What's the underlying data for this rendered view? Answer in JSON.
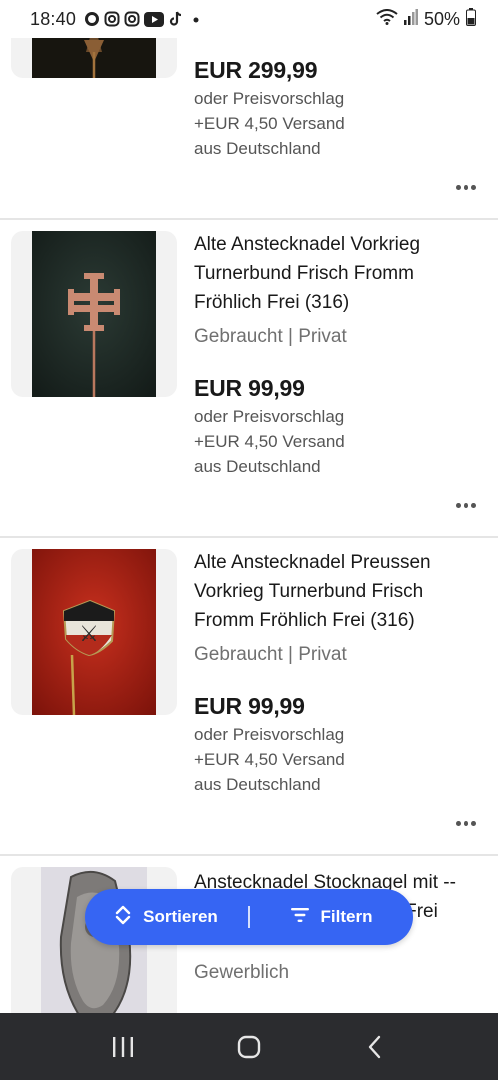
{
  "status_bar": {
    "time": "18:40",
    "battery": "50%",
    "notification_icons": [
      "chat-bubble-icon",
      "instagram-icon",
      "instagram-icon",
      "youtube-icon",
      "tiktok-icon",
      "dot-icon"
    ],
    "right_icons": [
      "wifi-icon",
      "signal-icon",
      "battery-icon"
    ]
  },
  "listings": [
    {
      "title": "",
      "condition": "",
      "price": "EUR 299,99",
      "offer": "oder Preisvorschlag",
      "shipping": "+EUR 4,50 Versand",
      "origin": "aus Deutschland"
    },
    {
      "title": "Alte Anstecknadel Vorkrieg Turnerbund Frisch Fromm Fröhlich Frei (316)",
      "condition": "Gebraucht | Privat",
      "price": "EUR 99,99",
      "offer": "oder Preisvorschlag",
      "shipping": "+EUR 4,50 Versand",
      "origin": "aus Deutschland"
    },
    {
      "title": "Alte Anstecknadel Preussen Vorkrieg Turnerbund Frisch Fromm Fröhlich Frei (316)",
      "condition": "Gebraucht | Privat",
      "price": "EUR 99,99",
      "offer": "oder Preisvorschlag",
      "shipping": "+EUR 4,50 Versand",
      "origin": "aus Deutschland"
    },
    {
      "title": "Anstecknadel Stocknagel mit -- Frisch, Fromm, Fröhlich, Frei",
      "condition": "Gewerblich"
    }
  ],
  "actions": {
    "sort_label": "Sortieren",
    "filter_label": "Filtern"
  },
  "colors": {
    "accent": "#3665f3",
    "nav_bar": "#2b2c2f",
    "secondary_text": "#707070"
  }
}
